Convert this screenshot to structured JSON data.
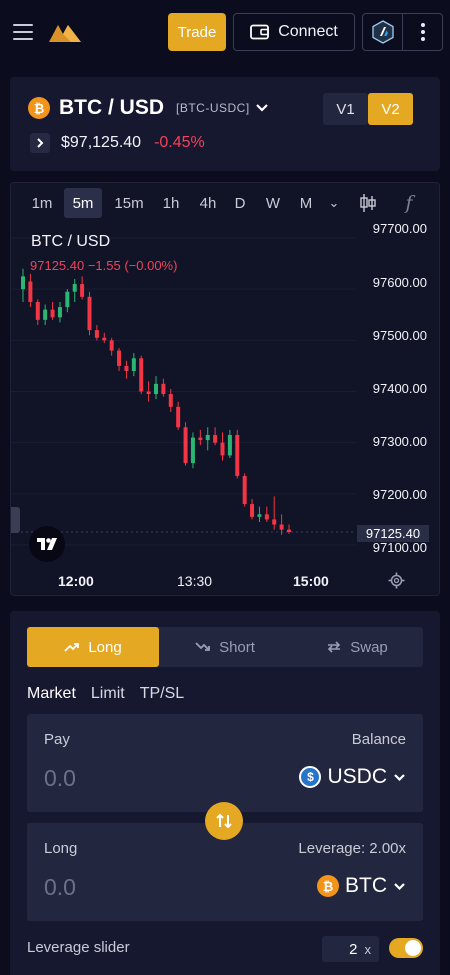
{
  "header": {
    "trade_label": "Trade",
    "connect_label": "Connect"
  },
  "market": {
    "pair": "BTC / USD",
    "ticker": "[BTC-USDC]",
    "coin_symbol": "₿",
    "price": "$97,125.40",
    "change": "-0.45%",
    "versions": [
      "V1",
      "V2"
    ],
    "active_version": "V2"
  },
  "chart": {
    "timeframes": [
      "1m",
      "5m",
      "15m",
      "1h",
      "4h",
      "D",
      "W",
      "M"
    ],
    "active_timeframe": "5m",
    "more_symbol": "⌄",
    "fx_symbol": "𝑓",
    "title": "BTC / USD",
    "ohlc_text": "97125.40 −1.55 (−0.00%)",
    "y_labels": [
      "97700.00",
      "97600.00",
      "97500.00",
      "97400.00",
      "97300.00",
      "97200.00",
      "97100.00"
    ],
    "price_tag": "97125.40",
    "x_labels": [
      "12:00",
      "13:30",
      "15:00"
    ]
  },
  "chart_data": {
    "type": "candlestick",
    "title": "BTC / USD",
    "ylim": [
      97080,
      97730
    ],
    "y_ticks": [
      97700,
      97600,
      97500,
      97400,
      97300,
      97200,
      97100
    ],
    "x_ticks": [
      "12:00",
      "13:30",
      "15:00"
    ],
    "last_price": 97125.4,
    "candles": [
      {
        "o": 97600,
        "h": 97640,
        "l": 97575,
        "c": 97625
      },
      {
        "o": 97615,
        "h": 97630,
        "l": 97565,
        "c": 97575
      },
      {
        "o": 97575,
        "h": 97580,
        "l": 97530,
        "c": 97540
      },
      {
        "o": 97540,
        "h": 97570,
        "l": 97530,
        "c": 97560
      },
      {
        "o": 97560,
        "h": 97575,
        "l": 97540,
        "c": 97545
      },
      {
        "o": 97545,
        "h": 97575,
        "l": 97535,
        "c": 97565
      },
      {
        "o": 97565,
        "h": 97600,
        "l": 97555,
        "c": 97595
      },
      {
        "o": 97595,
        "h": 97620,
        "l": 97575,
        "c": 97610
      },
      {
        "o": 97610,
        "h": 97625,
        "l": 97580,
        "c": 97585
      },
      {
        "o": 97585,
        "h": 97595,
        "l": 97510,
        "c": 97520
      },
      {
        "o": 97520,
        "h": 97530,
        "l": 97500,
        "c": 97505
      },
      {
        "o": 97505,
        "h": 97515,
        "l": 97495,
        "c": 97500
      },
      {
        "o": 97500,
        "h": 97505,
        "l": 97470,
        "c": 97480
      },
      {
        "o": 97480,
        "h": 97485,
        "l": 97440,
        "c": 97450
      },
      {
        "o": 97450,
        "h": 97460,
        "l": 97425,
        "c": 97440
      },
      {
        "o": 97440,
        "h": 97475,
        "l": 97430,
        "c": 97465
      },
      {
        "o": 97465,
        "h": 97470,
        "l": 97395,
        "c": 97400
      },
      {
        "o": 97400,
        "h": 97420,
        "l": 97380,
        "c": 97395
      },
      {
        "o": 97395,
        "h": 97430,
        "l": 97385,
        "c": 97415
      },
      {
        "o": 97415,
        "h": 97425,
        "l": 97390,
        "c": 97395
      },
      {
        "o": 97395,
        "h": 97405,
        "l": 97360,
        "c": 97370
      },
      {
        "o": 97370,
        "h": 97380,
        "l": 97325,
        "c": 97330
      },
      {
        "o": 97330,
        "h": 97340,
        "l": 97255,
        "c": 97260
      },
      {
        "o": 97260,
        "h": 97320,
        "l": 97250,
        "c": 97310
      },
      {
        "o": 97310,
        "h": 97325,
        "l": 97295,
        "c": 97305
      },
      {
        "o": 97305,
        "h": 97330,
        "l": 97285,
        "c": 97315
      },
      {
        "o": 97315,
        "h": 97330,
        "l": 97295,
        "c": 97300
      },
      {
        "o": 97300,
        "h": 97320,
        "l": 97265,
        "c": 97275
      },
      {
        "o": 97275,
        "h": 97325,
        "l": 97270,
        "c": 97315
      },
      {
        "o": 97315,
        "h": 97325,
        "l": 97230,
        "c": 97235
      },
      {
        "o": 97235,
        "h": 97240,
        "l": 97175,
        "c": 97180
      },
      {
        "o": 97180,
        "h": 97190,
        "l": 97150,
        "c": 97155
      },
      {
        "o": 97155,
        "h": 97175,
        "l": 97145,
        "c": 97160
      },
      {
        "o": 97160,
        "h": 97175,
        "l": 97145,
        "c": 97150
      },
      {
        "o": 97150,
        "h": 97195,
        "l": 97130,
        "c": 97140
      },
      {
        "o": 97140,
        "h": 97160,
        "l": 97120,
        "c": 97130
      },
      {
        "o": 97130,
        "h": 97140,
        "l": 97122,
        "c": 97125.4
      }
    ]
  },
  "order": {
    "tabs": [
      "Long",
      "Short",
      "Swap"
    ],
    "active_tab": "Long",
    "types": [
      "Market",
      "Limit",
      "TP/SL"
    ],
    "active_type": "Market",
    "pay": {
      "label": "Pay",
      "right_label": "Balance",
      "value": "0.0",
      "token": "USDC",
      "token_symbol": "$"
    },
    "long": {
      "label": "Long",
      "right_label": "Leverage: 2.00x",
      "value": "0.0",
      "token": "BTC",
      "token_symbol": "₿"
    },
    "leverage_label": "Leverage slider",
    "leverage_value": "2",
    "leverage_unit": "x",
    "leverage_slider_enabled": true
  },
  "colors": {
    "accent": "#e5a823",
    "up": "#2bb673",
    "down": "#f23645",
    "background": "#0b0d1f"
  }
}
